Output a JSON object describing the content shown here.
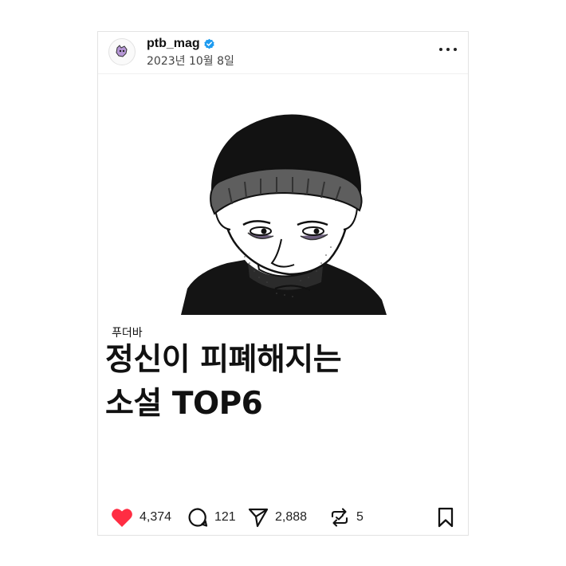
{
  "post": {
    "username": "ptb_mag",
    "date": "2023년 10월 8일",
    "kicker": "푸더바",
    "headline_line1": "정신이 피폐해지는",
    "headline_line2": "소설 TOP6"
  },
  "actions": {
    "likes": "4,374",
    "comments": "121",
    "shares": "2,888",
    "reposts": "5"
  },
  "icons": {
    "verified": "verified-badge-icon",
    "more": "more-options-icon",
    "like": "heart-icon",
    "comment": "comment-bubble-icon",
    "share": "paper-plane-icon",
    "repost": "repost-icon",
    "bookmark": "bookmark-icon"
  },
  "colors": {
    "like_red": "#ff2d43",
    "verified_blue": "#1d9bf0",
    "avatar_purple": "#b697d6"
  }
}
